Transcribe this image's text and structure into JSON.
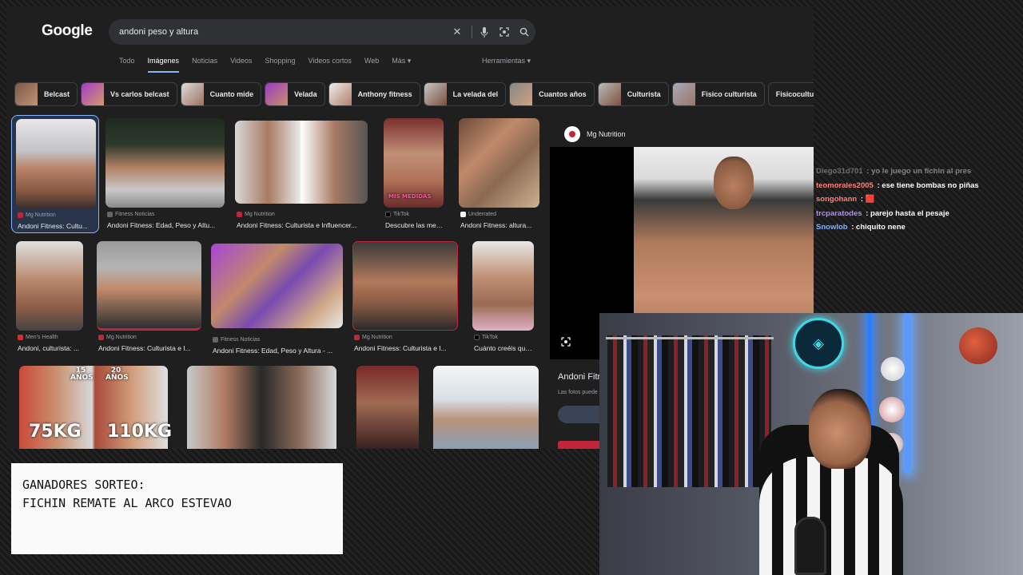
{
  "google": {
    "logo": "Google",
    "query": "andoni peso y altura",
    "tabs": [
      "Todo",
      "Imágenes",
      "Noticias",
      "Videos",
      "Shopping",
      "Videos cortos",
      "Web",
      "Más ▾"
    ],
    "tools": "Herramientas ▾",
    "chips": [
      "Belcast",
      "Vs carlos belcast",
      "Cuanto mide",
      "Velada",
      "Anthony fitness",
      "La velada del",
      "Cuantos años",
      "Culturista",
      "Fisico culturista",
      "Fisicoculturista"
    ]
  },
  "results": [
    {
      "source": "Mg Nutrition",
      "title": "Andoni Fitness: Cultu..."
    },
    {
      "source": "Fitness Noticias",
      "title": "Andoni Fitness: Edad, Peso y Altu..."
    },
    {
      "source": "Mg Nutrition",
      "title": "Andoni Fitness: Culturista e Influencer..."
    },
    {
      "source": "TikTok",
      "title": "Descubre las medi..."
    },
    {
      "source": "Underrated",
      "title": "Andoni Fitness: altura..."
    },
    {
      "source": "Men's Health",
      "title": "Andoni, culturista: ..."
    },
    {
      "source": "Mg Nutrition",
      "title": "Andoni Fitness: Culturista e I..."
    },
    {
      "source": "Fitness Noticias",
      "title": "Andoni Fitness: Edad, Peso y Altura - ..."
    },
    {
      "source": "Mg Nutrition",
      "title": "Andoni Fitness: Culturista e I..."
    },
    {
      "source": "TikTok",
      "title": "Cuánto creéis que ..."
    }
  ],
  "thumb_text": {
    "mis_medidas": "MIS MEDIDAS",
    "age15": "15 AÑOS",
    "age20": "20 AÑOS",
    "w75": "75KG",
    "w110": "110KG"
  },
  "preview": {
    "source": "Mg Nutrition",
    "title": "Andoni Fitr",
    "subtitle": "Las fotos puede"
  },
  "chat": [
    {
      "user": "Diego31d701",
      "text": "yo le juego un fichin al pres",
      "color": "#cfcfcf",
      "faded": true
    },
    {
      "user": "teomorales2005",
      "text": "ese tiene bombas no piñas",
      "color": "#ff7f7f"
    },
    {
      "user": "songohann",
      "text": "🟥",
      "color": "#ff7f7f"
    },
    {
      "user": "trcparatodes",
      "text": "parejo hasta el pesaje",
      "color": "#b48cff"
    },
    {
      "user": "Snowlob",
      "text": "chiquito nene",
      "color": "#7fb2ff"
    }
  ],
  "winners": {
    "line1": "GANADORES SORTEO:",
    "line2": "FICHIN REMATE AL ARCO ESTEVAO"
  },
  "colors": {
    "accent": "#8ab4f8",
    "bg": "#1f1f1f",
    "chip_border": "#3c4043"
  }
}
